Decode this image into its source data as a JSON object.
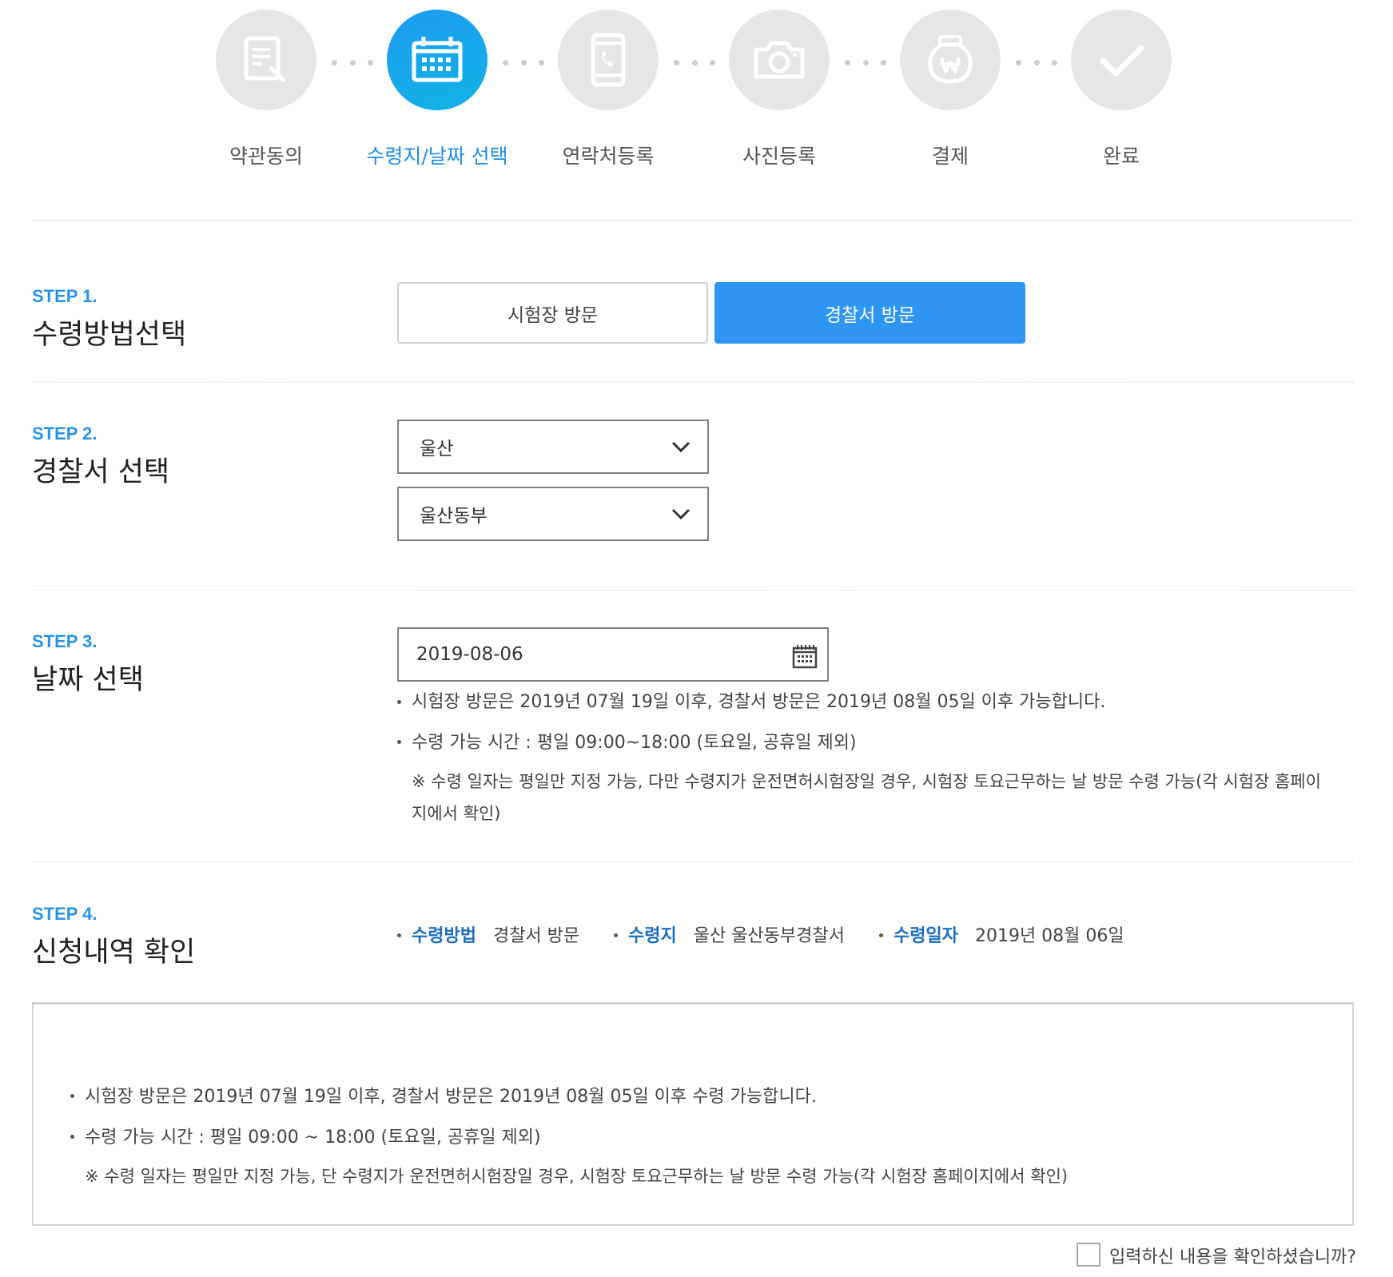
{
  "progress": {
    "steps": [
      {
        "label": "약관동의",
        "icon": "document-pen-icon",
        "active": false
      },
      {
        "label": "수령지/날짜 선택",
        "icon": "calendar-icon",
        "active": true
      },
      {
        "label": "연락처등록",
        "icon": "phone-icon",
        "active": false
      },
      {
        "label": "사진등록",
        "icon": "camera-icon",
        "active": false
      },
      {
        "label": "결제",
        "icon": "won-bag-icon",
        "active": false
      },
      {
        "label": "완료",
        "icon": "check-icon",
        "active": false
      }
    ]
  },
  "colors": {
    "accent": "#2f95f2",
    "step_label": "#2a93e8",
    "summary_key": "#1d6fc0",
    "inactive_circle": "#e6e6e6"
  },
  "step1": {
    "num": "STEP 1.",
    "title": "수령방법선택",
    "options": [
      "시험장 방문",
      "경찰서 방문"
    ],
    "selected": "경찰서 방문"
  },
  "step2": {
    "num": "STEP 2.",
    "title": "경찰서 선택",
    "region": "울산",
    "station": "울산동부"
  },
  "step3": {
    "num": "STEP 3.",
    "title": "날짜 선택",
    "date": "2019-08-06",
    "notes": [
      "시험장 방문은 2019년 07월 19일 이후, 경찰서 방문은 2019년 08월 05일 이후 가능합니다.",
      "수령 가능 시간 : 평일 09:00~18:00 (토요일, 공휴일 제외)"
    ],
    "remark_line1": "※ 수령 일자는 평일만 지정 가능, 다만 수령지가 운전면허시험장일 경우, 시험장 토요근무하는 날 방문 수령 가능(각 시험장 홈페이",
    "remark_line2": "지에서 확인)"
  },
  "step4": {
    "num": "STEP 4.",
    "title": "신청내역 확인",
    "summary": [
      {
        "key": "수령방법",
        "value": "경찰서 방문"
      },
      {
        "key": "수령지",
        "value": "울산 울산동부경찰서"
      },
      {
        "key": "수령일자",
        "value": "2019년 08월 06일"
      }
    ]
  },
  "infobox": {
    "notes": [
      "시험장 방문은 2019년 07월 19일 이후, 경찰서 방문은 2019년 08월 05일 이후 수령 가능합니다.",
      "수령 가능 시간 : 평일 09:00 ~ 18:00 (토요일, 공휴일 제외)"
    ],
    "remark": "※ 수령 일자는 평일만 지정 가능, 단 수령지가 운전면허시험장일 경우, 시험장 토요근무하는 날 방문 수령 가능(각 시험장 홈페이지에서 확인)"
  },
  "confirm": {
    "label": "입력하신 내용을 확인하셨습니까?",
    "checked": false
  }
}
